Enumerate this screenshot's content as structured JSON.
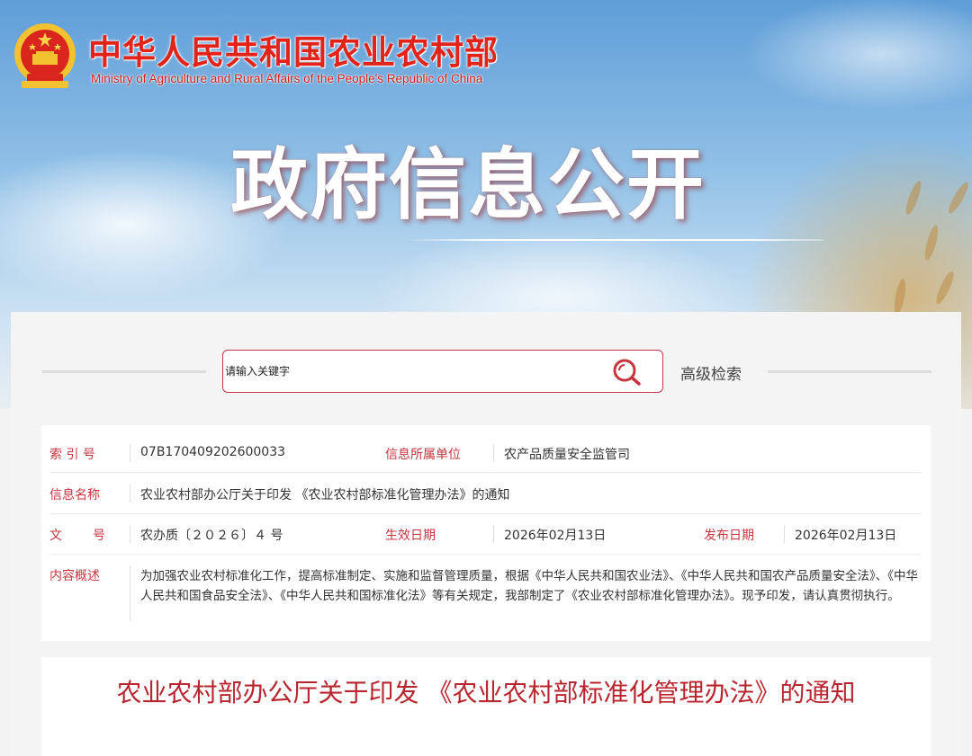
{
  "header": {
    "ministry_name_cn": "中华人民共和国农业农村部",
    "ministry_name_en": "Ministry of Agriculture and Rural Affairs of the People's Republic of China",
    "section_title": "政府信息公开"
  },
  "search": {
    "placeholder": "请输入关键字",
    "value": "",
    "advanced_label": "高级检索"
  },
  "info": {
    "index_label": "索 引 号",
    "index_value": "07B170409202600033",
    "unit_label": "信息所属单位",
    "unit_value": "农产品质量安全监管司",
    "name_label": "信息名称",
    "name_value": "农业农村部办公厅关于印发 《农业农村部标准化管理办法》的通知",
    "doc_no_label_1": "文",
    "doc_no_label_2": "号",
    "doc_no_value": "农办质〔２０２６〕４ 号",
    "effective_label": "生效日期",
    "effective_value": "2026年02月13日",
    "publish_label": "发布日期",
    "publish_value": "2026年02月13日",
    "summary_label": "内容概述",
    "summary_value": "为加强农业农村标准化工作，提高标准制定、实施和监督管理质量，根据《中华人民共和国农业法》、《中华人民共和国农产品质量安全法》、《中华人民共和国食品安全法》、《中华人民共和国标准化法》等有关规定，我部制定了《农业农村部标准化管理办法》。现予印发，请认真贯彻执行。"
  },
  "article": {
    "title": "农业农村部办公厅关于印发 《农业农村部标准化管理办法》的通知"
  },
  "colors": {
    "accent_red": "#c8343e",
    "title_red": "#b8262f"
  }
}
